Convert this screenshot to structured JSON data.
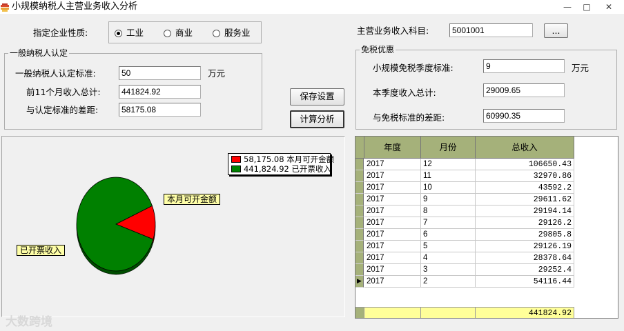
{
  "window": {
    "title": "小规模纳税人主营业务收入分析",
    "minimize": "—",
    "maximize": "□",
    "close": "✕"
  },
  "enterprise": {
    "label": "指定企业性质:",
    "options": [
      "工业",
      "商业",
      "服务业"
    ],
    "selected": "工业"
  },
  "subject": {
    "label": "主营业务收入科目:",
    "value": "5001001",
    "browse_label": "..."
  },
  "general": {
    "title": "一般纳税人认定",
    "standard_label": "一般纳税人认定标准:",
    "standard_value": "50",
    "standard_unit": "万元",
    "total_label": "前11个月收入总计:",
    "total_value": "441824.92",
    "gap_label": "与认定标准的差距:",
    "gap_value": "58175.08"
  },
  "actions": {
    "save_label": "保存设置",
    "calc_label": "计算分析"
  },
  "exempt": {
    "title": "免税优惠",
    "standard_label": "小规模免税季度标准:",
    "standard_value": "9",
    "standard_unit": "万元",
    "quarter_label": "本季度收入总计:",
    "quarter_value": "29009.65",
    "gap_label": "与免税标准的差距:",
    "gap_value": "60990.35"
  },
  "chart": {
    "legend": [
      {
        "value": "58,175.08",
        "name": "本月可开金额",
        "color": "#ff0000"
      },
      {
        "value": "441,824.92",
        "name": "已开票收入",
        "color": "#008000"
      }
    ],
    "callout_red": "本月可开金额",
    "callout_green": "已开票收入"
  },
  "chart_data": {
    "type": "pie",
    "title": "",
    "slices": [
      {
        "label": "本月可开金额",
        "value": 58175.08,
        "color": "#ff0000"
      },
      {
        "label": "已开票收入",
        "value": 441824.92,
        "color": "#008000"
      }
    ]
  },
  "table": {
    "columns": [
      "年度",
      "月份",
      "总收入"
    ],
    "rows": [
      [
        "2017",
        "12",
        "106650.43"
      ],
      [
        "2017",
        "11",
        "32970.86"
      ],
      [
        "2017",
        "10",
        "43592.2"
      ],
      [
        "2017",
        "9",
        "29611.62"
      ],
      [
        "2017",
        "8",
        "29194.14"
      ],
      [
        "2017",
        "7",
        "29126.2"
      ],
      [
        "2017",
        "6",
        "29805.8"
      ],
      [
        "2017",
        "5",
        "29126.19"
      ],
      [
        "2017",
        "4",
        "28378.64"
      ],
      [
        "2017",
        "3",
        "29252.4"
      ],
      [
        "2017",
        "2",
        "54116.44"
      ]
    ],
    "current_row_indicator": "▶",
    "footer_total": "441824.92"
  },
  "watermark": "大数跨境"
}
